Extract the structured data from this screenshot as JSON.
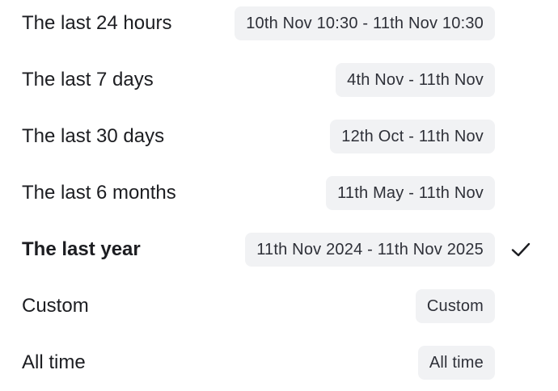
{
  "options": [
    {
      "label": "The last 24 hours",
      "range": "10th Nov 10:30 - 11th Nov 10:30",
      "selected": false
    },
    {
      "label": "The last 7 days",
      "range": "4th Nov - 11th Nov",
      "selected": false
    },
    {
      "label": "The last 30 days",
      "range": "12th Oct - 11th Nov",
      "selected": false
    },
    {
      "label": "The last 6 months",
      "range": "11th May - 11th Nov",
      "selected": false
    },
    {
      "label": "The last year",
      "range": "11th Nov 2024 - 11th Nov 2025",
      "selected": true
    },
    {
      "label": "Custom",
      "range": "Custom",
      "selected": false
    },
    {
      "label": "All time",
      "range": "All time",
      "selected": false
    }
  ],
  "icons": {
    "selected_indicator": "check-icon"
  },
  "colors": {
    "text": "#1c1d21",
    "chip_background": "#f1f2f4",
    "chip_text": "#2e3038"
  }
}
